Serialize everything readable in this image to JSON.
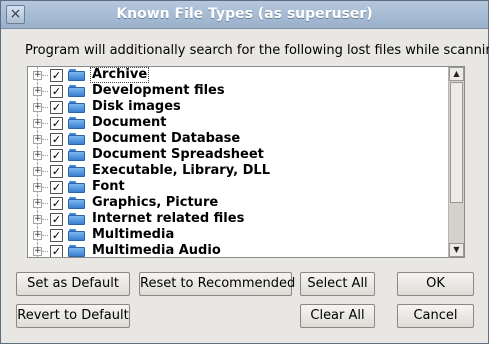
{
  "window": {
    "title": "Known File Types (as superuser)",
    "close_glyph": "×"
  },
  "prompt": "Program will additionally search for the following lost files while scanning",
  "tree": {
    "items": [
      {
        "label": "Archive",
        "checked": true
      },
      {
        "label": "Development files",
        "checked": true
      },
      {
        "label": "Disk images",
        "checked": true
      },
      {
        "label": "Document",
        "checked": true
      },
      {
        "label": "Document Database",
        "checked": true
      },
      {
        "label": "Document Spreadsheet",
        "checked": true
      },
      {
        "label": "Executable, Library, DLL",
        "checked": true
      },
      {
        "label": "Font",
        "checked": true
      },
      {
        "label": "Graphics, Picture",
        "checked": true
      },
      {
        "label": "Internet related files",
        "checked": true
      },
      {
        "label": "Multimedia",
        "checked": true
      },
      {
        "label": "Multimedia Audio",
        "checked": true
      }
    ],
    "expander_glyph": "+",
    "check_glyph": "✓",
    "icon": "folder-icon"
  },
  "scrollbar": {
    "up_glyph": "▲",
    "down_glyph": "▼"
  },
  "buttons": {
    "set_default": "Set as Default",
    "reset_recommended": "Reset to Recommended",
    "select_all": "Select All",
    "ok": "OK",
    "revert_default": "Revert to Default",
    "clear_all": "Clear All",
    "cancel": "Cancel"
  },
  "colors": {
    "titlebar": "#9ab0cb",
    "folder": "#3a7fd0"
  }
}
